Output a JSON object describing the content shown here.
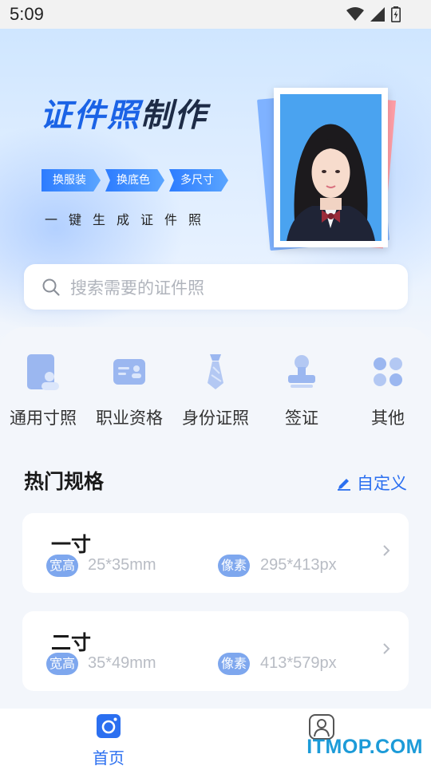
{
  "status_bar": {
    "time": "5:09"
  },
  "banner": {
    "title_blue": "证件照",
    "title_dark": "制作",
    "tags": [
      "换服装",
      "换底色",
      "多尺寸"
    ],
    "slogan": "一键生成证件照"
  },
  "search": {
    "placeholder": "搜索需要的证件照"
  },
  "categories": [
    {
      "label": "通用寸照",
      "icon": "portrait-card-icon"
    },
    {
      "label": "职业资格",
      "icon": "id-card-icon"
    },
    {
      "label": "身份证照",
      "icon": "necktie-icon"
    },
    {
      "label": "签证",
      "icon": "stamp-icon"
    },
    {
      "label": "其他",
      "icon": "four-petal-icon"
    }
  ],
  "hot_specs": {
    "title": "热门规格",
    "custom_label": "自定义",
    "items": [
      {
        "name": "一寸",
        "size_badge": "宽高",
        "size": "25*35mm",
        "pixel_badge": "像素",
        "pixels": "295*413px"
      },
      {
        "name": "二寸",
        "size_badge": "宽高",
        "size": "35*49mm",
        "pixel_badge": "像素",
        "pixels": "413*579px"
      }
    ]
  },
  "bottom_nav": {
    "home_label": "首页"
  },
  "watermark": "ITMOP.COM",
  "colors": {
    "accent": "#2b6ff0",
    "badge": "#7ea7ee",
    "photo_bg": "#4aa3f0"
  }
}
